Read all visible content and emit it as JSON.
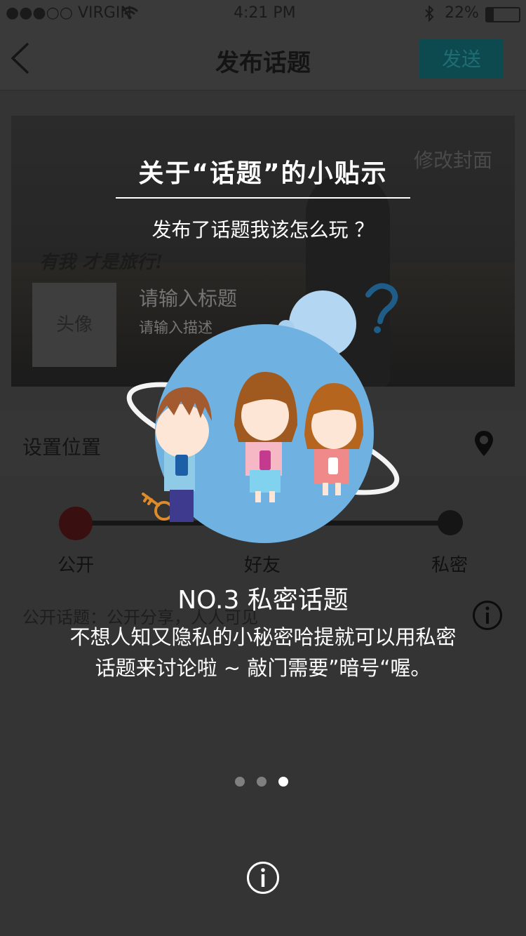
{
  "status": {
    "carrier": "●●●○○ VIRGIN",
    "time": "4:21 PM",
    "battery": "22%"
  },
  "nav": {
    "title": "发布话题",
    "send_label": "发送"
  },
  "cover": {
    "edit_label": "修改封面",
    "script_text": "有我  才是旅行!",
    "avatar_label": "头像",
    "title_placeholder": "请输入标题",
    "desc_placeholder": "请输入描述"
  },
  "location": {
    "label": "设置位置"
  },
  "privacy": {
    "options": [
      "公开",
      "好友",
      "私密"
    ],
    "hint": "公开话题：公开分享，人人可见"
  },
  "tip": {
    "title": "关于“话题”的小贴示",
    "subtitle": "发布了话题我该怎么玩 ？",
    "heading": "NO.3  私密话题",
    "line1": "不想人知又隐私的小秘密哈提就可以用私密",
    "line2": "话题来讨论啦 ~ 敲门需要”暗号“喔。",
    "page_current": 3,
    "page_total": 3
  },
  "colors": {
    "accent_send": "#0d4a50",
    "illustration_bg": "#6fb1e0"
  },
  "icons": [
    "back-icon",
    "wifi-icon",
    "bluetooth-icon",
    "battery-icon",
    "location-pin-icon",
    "info-icon",
    "key-icon",
    "question-icon"
  ]
}
